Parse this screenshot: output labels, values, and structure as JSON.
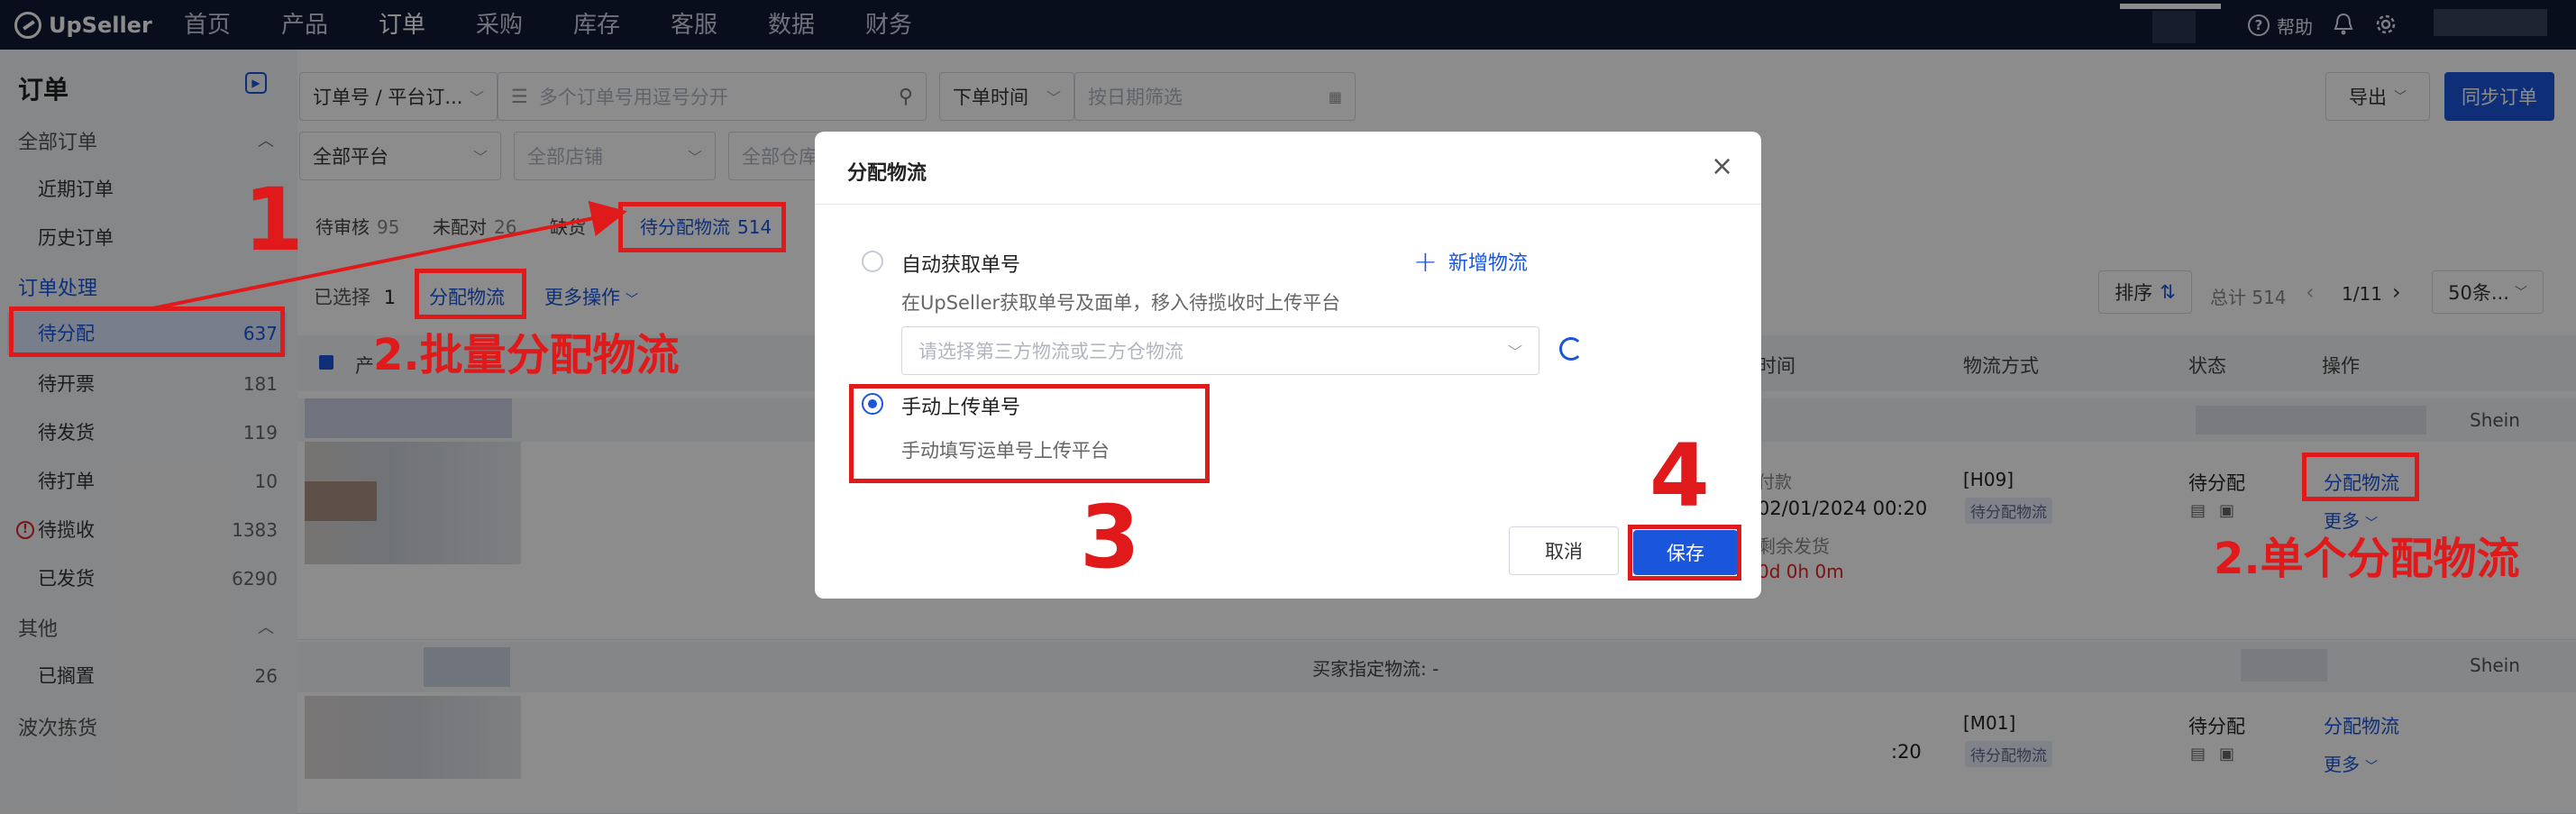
{
  "app": {
    "logo": "UpSeller"
  },
  "topnav": {
    "items": [
      "首页",
      "产品",
      "订单",
      "采购",
      "库存",
      "客服",
      "数据",
      "财务"
    ],
    "active": "订单",
    "help": "帮助"
  },
  "sidebar": {
    "title": "订单",
    "groups": [
      {
        "label": "全部订单",
        "items": [
          {
            "label": "近期订单"
          },
          {
            "label": "历史订单"
          }
        ]
      },
      {
        "label": "订单处理",
        "items": [
          {
            "label": "待分配",
            "count": "637"
          },
          {
            "label": "待开票",
            "count": "181"
          },
          {
            "label": "待发货",
            "count": "119"
          },
          {
            "label": "待打单",
            "count": "10"
          },
          {
            "label": "待揽收",
            "count": "1383"
          },
          {
            "label": "已发货",
            "count": "6290"
          }
        ]
      },
      {
        "label": "其他",
        "items": [
          {
            "label": "已搁置",
            "count": "26"
          }
        ]
      },
      {
        "label": "波次拣货",
        "items": []
      }
    ]
  },
  "filters": {
    "order_no_select": "订单号 / 平台订...",
    "order_no_placeholder": "多个订单号用逗号分开",
    "time_select": "下单时间",
    "date_placeholder": "按日期筛选",
    "platform_select": "全部平台",
    "store_placeholder": "全部店铺",
    "warehouse_placeholder": "全部仓库"
  },
  "actions": {
    "export": "导出",
    "sync": "同步订单"
  },
  "tabs": [
    {
      "label": "待审核",
      "count": "95"
    },
    {
      "label": "未配对",
      "count": "26"
    },
    {
      "label": "缺货",
      "count": ""
    },
    {
      "label": "待分配物流",
      "count": "514"
    }
  ],
  "toolbar": {
    "selected_label": "已选择",
    "selected_count": "1",
    "assign": "分配物流",
    "more_ops": "更多操作",
    "sort": "排序",
    "total": "总计 514",
    "page": "1/11",
    "page_size": "50条..."
  },
  "table": {
    "headers": {
      "product": "产",
      "time": "时间",
      "shipping": "物流方式",
      "status": "状态",
      "ops": "操作"
    },
    "rows": [
      {
        "platform": "Shein",
        "time_label": "付款",
        "time": "02/01/2024 00:20",
        "remain_label": "剩余发货",
        "remain": "0d 0h 0m",
        "shipping_code": "[H09]",
        "shipping_tag": "待分配物流",
        "status": "待分配",
        "op_assign": "分配物流",
        "op_more": "更多"
      },
      {
        "band_text": "买家指定物流: -",
        "platform": "Shein",
        "time": ":20",
        "shipping_code": "[M01]",
        "shipping_tag": "待分配物流",
        "status": "待分配",
        "op_assign": "分配物流",
        "op_more": "更多"
      }
    ]
  },
  "modal": {
    "title": "分配物流",
    "option_auto": "自动获取单号",
    "option_auto_desc": "在UpSeller获取单号及面单，移入待揽收时上传平台",
    "add_logistics": "新增物流",
    "select_placeholder": "请选择第三方物流或三方仓物流",
    "option_manual": "手动上传单号",
    "option_manual_desc": "手动填写运单号上传平台",
    "cancel": "取消",
    "save": "保存"
  },
  "annotations": {
    "step1": "1",
    "step2_batch": "2.批量分配物流",
    "step2_single": "2.单个分配物流",
    "step3": "3",
    "step4": "4",
    "color": "#e0191b"
  }
}
